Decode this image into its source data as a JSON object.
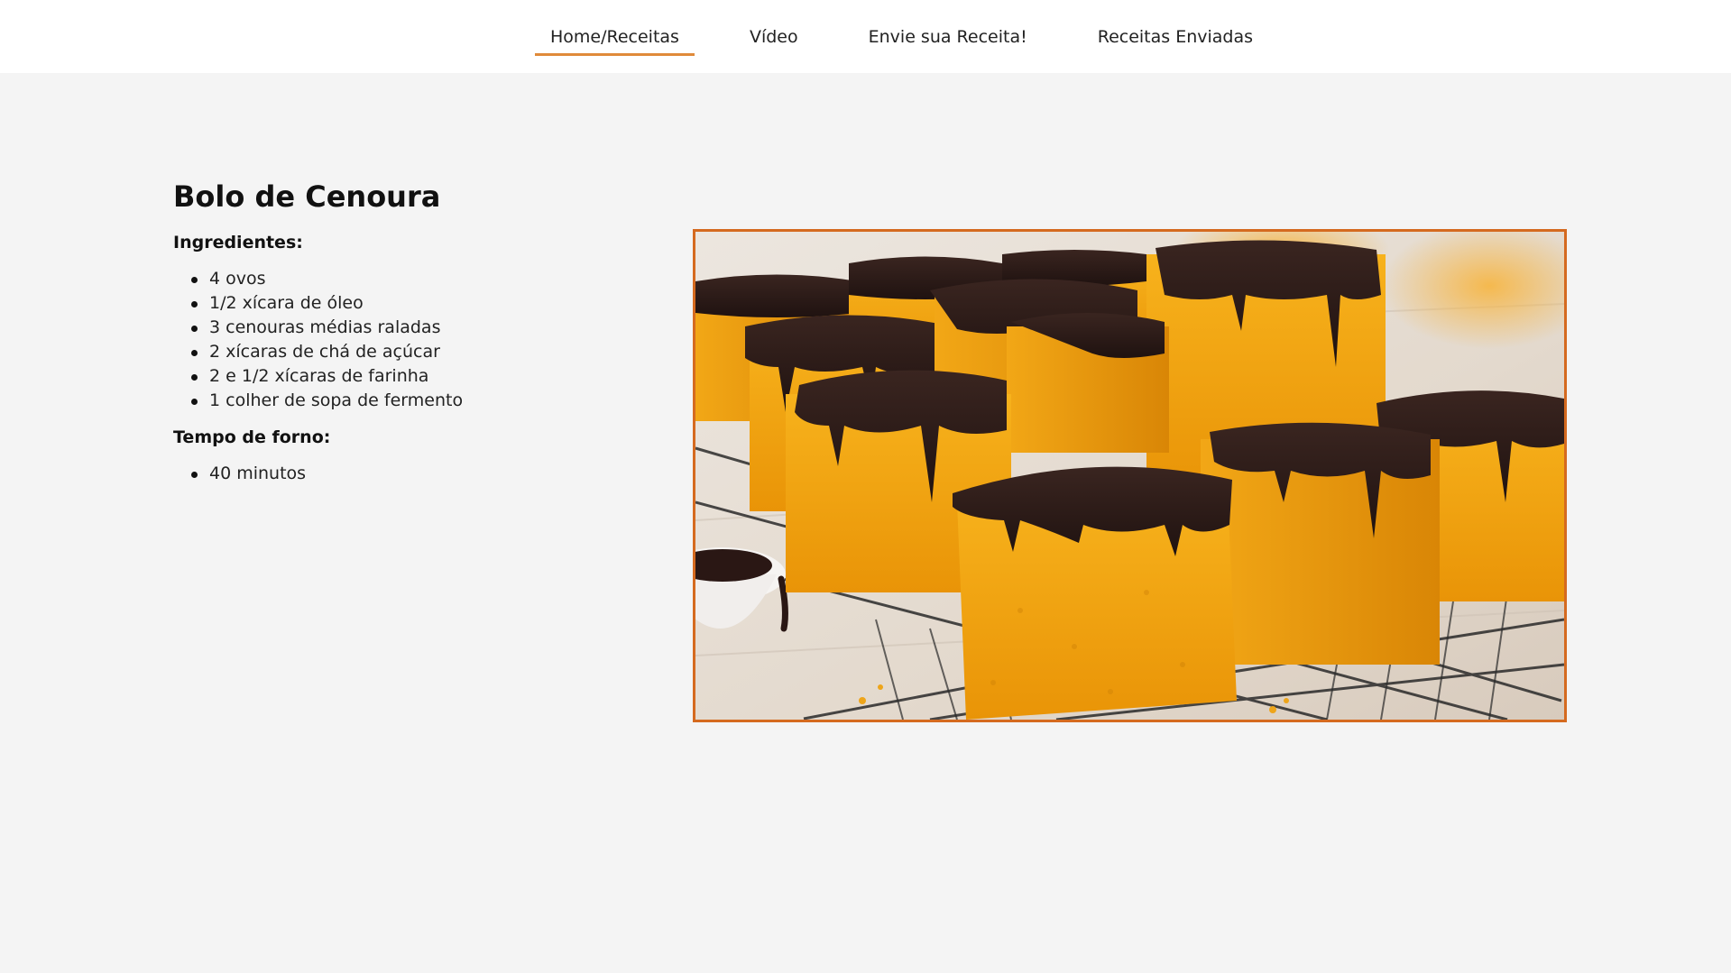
{
  "nav": {
    "items": [
      {
        "label": "Home/Receitas",
        "active": true
      },
      {
        "label": "Vídeo",
        "active": false
      },
      {
        "label": "Envie sua Receita!",
        "active": false
      },
      {
        "label": "Receitas Enviadas",
        "active": false
      }
    ]
  },
  "recipe": {
    "title": "Bolo de Cenoura",
    "ingredients_label": "Ingredientes:",
    "ingredients": [
      "4 ovos",
      "1/2 xícara de óleo",
      "3 cenouras médias raladas",
      "2 xícaras de chá de açúcar",
      "2 e 1/2 xícaras de farinha",
      "1 colher de sopa de fermento"
    ],
    "oven_label": "Tempo de forno:",
    "oven_items": [
      "40 minutos"
    ]
  },
  "image": {
    "subject": "carrot-cake-with-chocolate-icing-photo"
  },
  "colors": {
    "accent": "#e08a3a",
    "image_border": "#d56a1f",
    "background": "#f4f4f4",
    "header": "#ffffff"
  }
}
